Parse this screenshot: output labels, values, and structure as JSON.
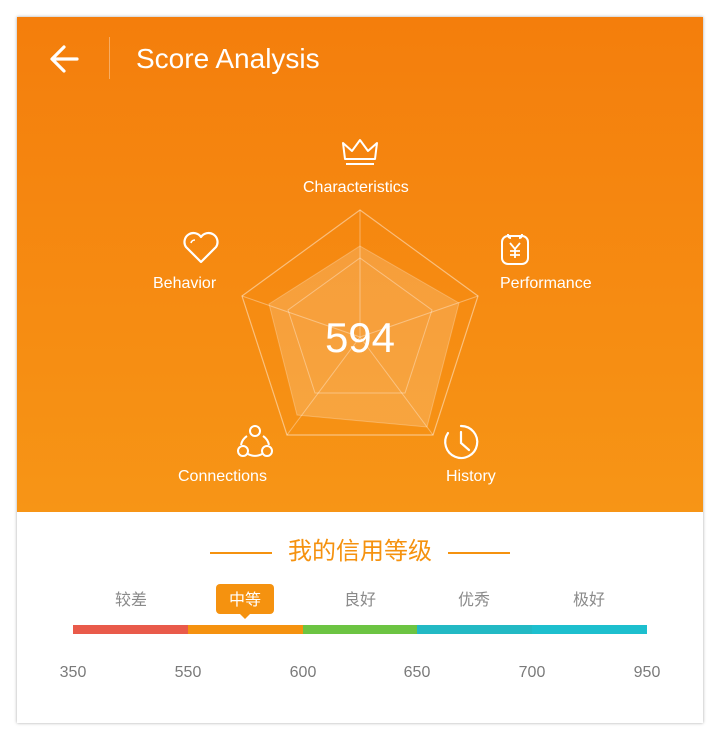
{
  "header": {
    "title": "Score Analysis",
    "back_icon": "arrow-left-icon"
  },
  "radar": {
    "score": "594",
    "dimensions": [
      {
        "label": "Characteristics",
        "icon": "crown-icon"
      },
      {
        "label": "Performance",
        "icon": "yen-badge-icon"
      },
      {
        "label": "History",
        "icon": "clock-icon"
      },
      {
        "label": "Connections",
        "icon": "network-icon"
      },
      {
        "label": "Behavior",
        "icon": "heart-icon"
      }
    ]
  },
  "credit": {
    "section_title": "我的信用等级",
    "tiers": [
      "较差",
      "中等",
      "良好",
      "优秀",
      "极好"
    ],
    "active_tier": "中等",
    "ticks": [
      "350",
      "550",
      "600",
      "650",
      "700",
      "950"
    ],
    "colors": [
      "#e95a4a",
      "#f5920f",
      "#6cc442",
      "#22b9c4",
      "#1dbfce"
    ]
  },
  "colors": {
    "header_orange": "#f47e0c",
    "accent": "#f5920f"
  }
}
